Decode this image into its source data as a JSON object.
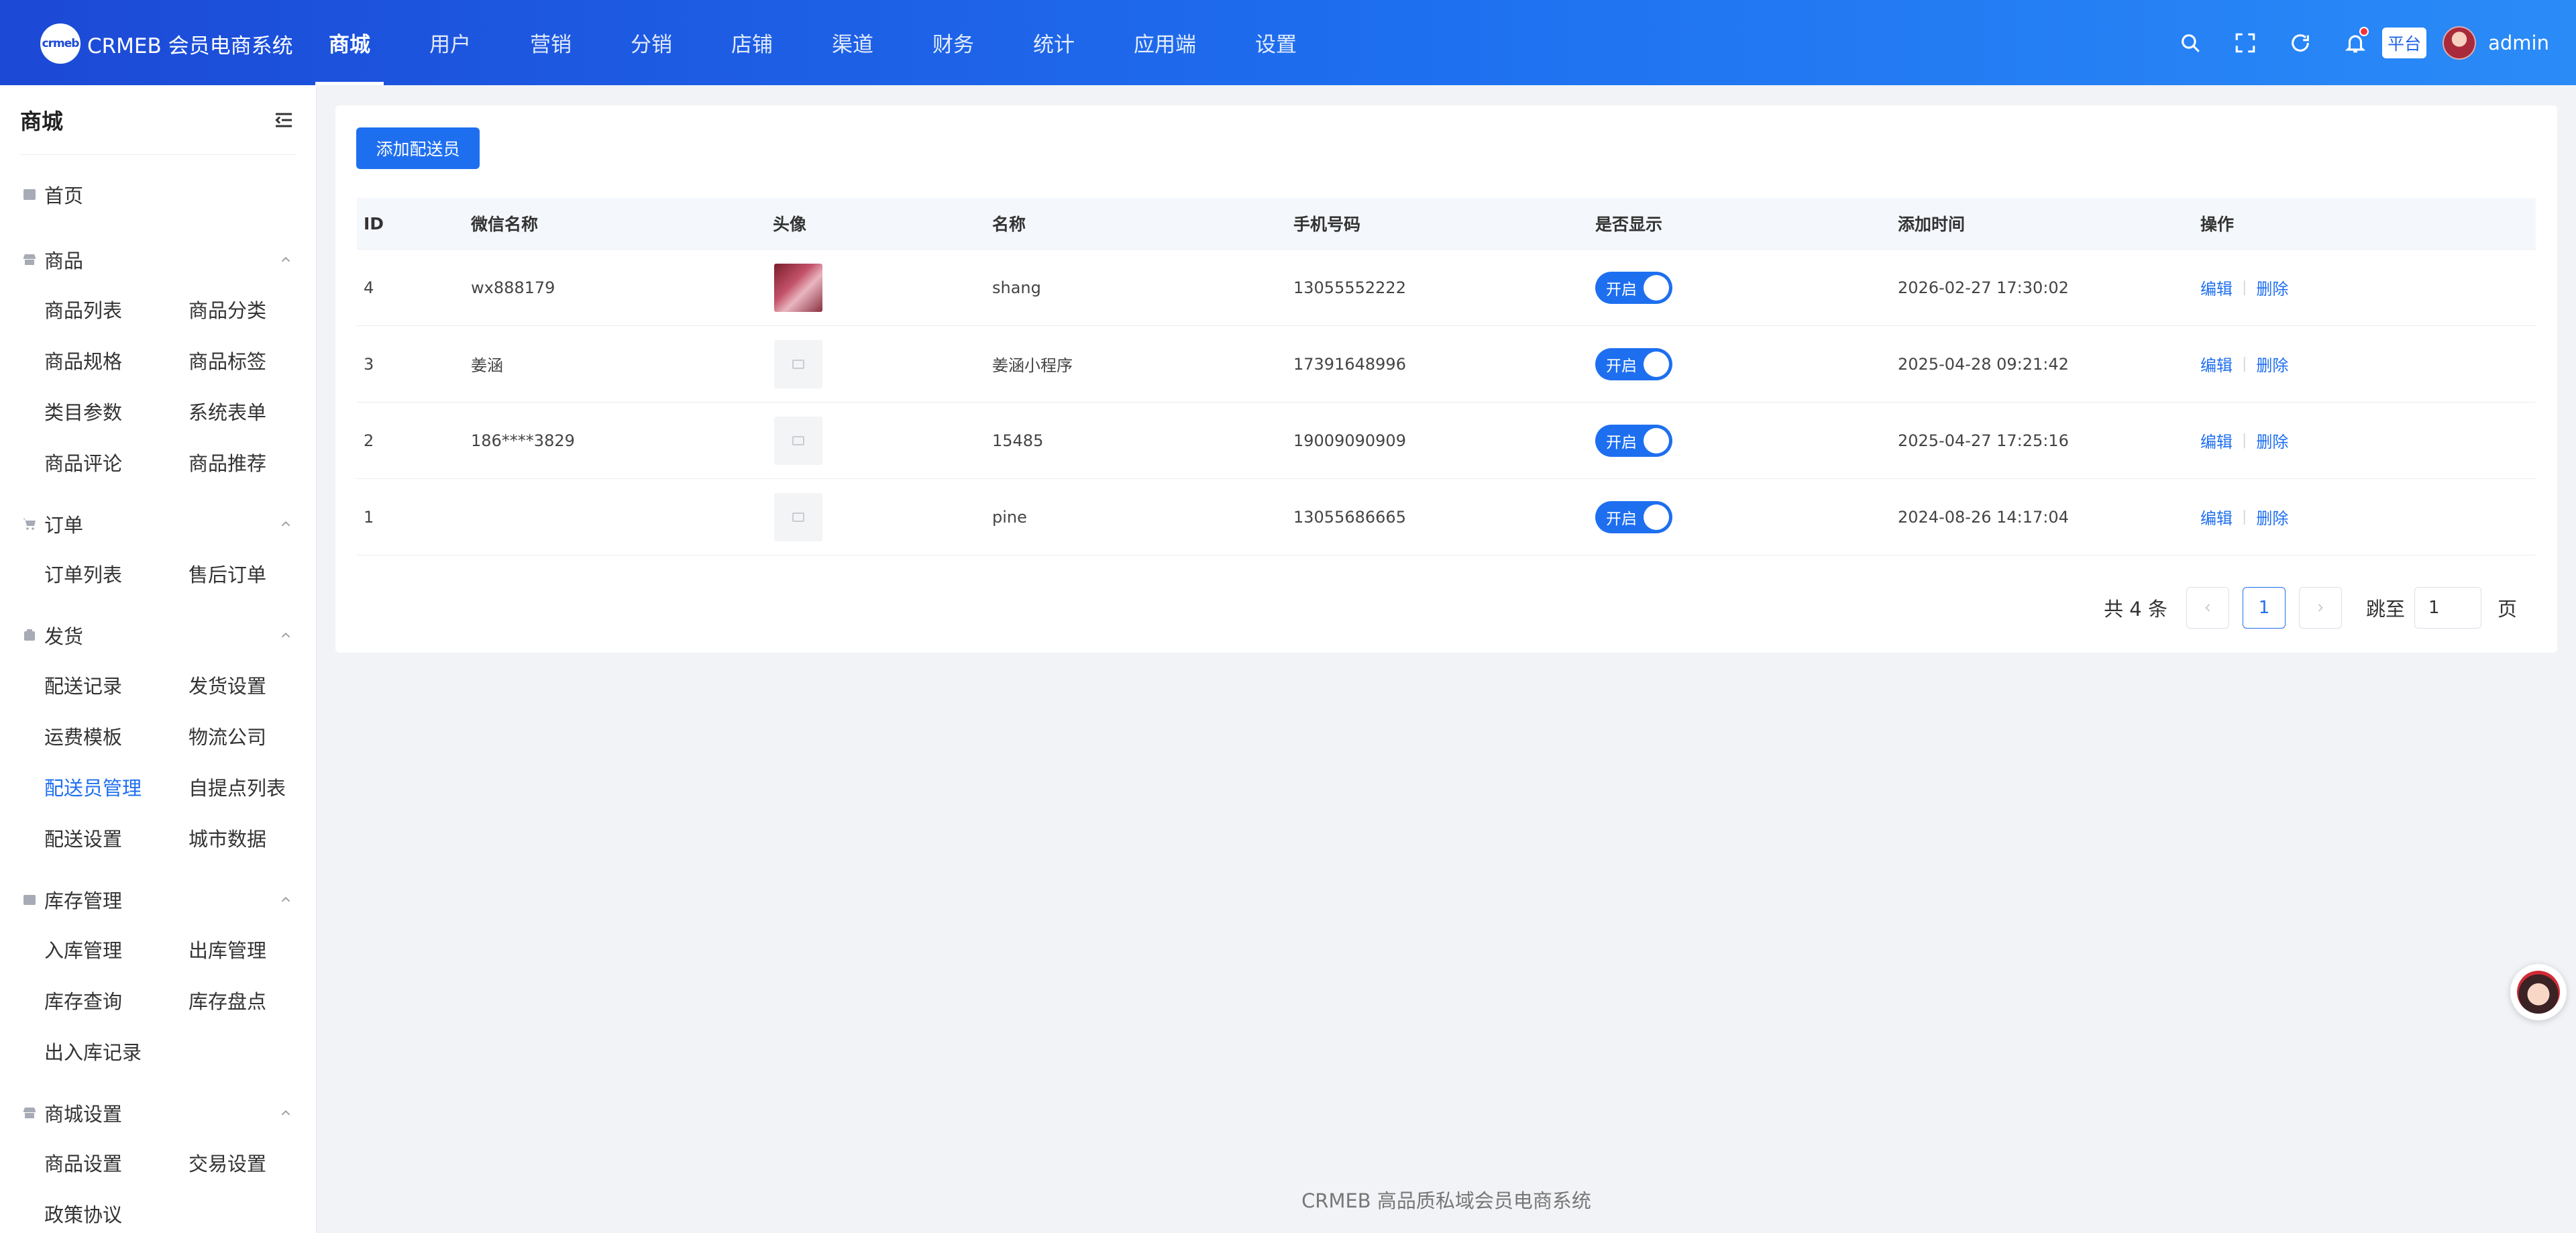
{
  "brand": {
    "logo_text": "crmeb",
    "title": "CRMEB 会员电商系统"
  },
  "topnav": [
    {
      "label": "商城",
      "active": true
    },
    {
      "label": "用户"
    },
    {
      "label": "营销"
    },
    {
      "label": "分销"
    },
    {
      "label": "店铺"
    },
    {
      "label": "渠道"
    },
    {
      "label": "财务"
    },
    {
      "label": "统计"
    },
    {
      "label": "应用端"
    },
    {
      "label": "设置"
    }
  ],
  "topbar_right": {
    "icons": [
      "search-icon",
      "fullscreen-icon",
      "refresh-icon",
      "bell-icon"
    ],
    "platform_badge": "平台",
    "user": "admin"
  },
  "sidebar": {
    "title": "商城",
    "home": "首页",
    "groups": [
      {
        "title": "商品",
        "items": [
          "商品列表",
          "商品分类",
          "商品规格",
          "商品标签",
          "类目参数",
          "系统表单",
          "商品评论",
          "商品推荐"
        ]
      },
      {
        "title": "订单",
        "items": [
          "订单列表",
          "售后订单"
        ]
      },
      {
        "title": "发货",
        "items": [
          "配送记录",
          "发货设置",
          "运费模板",
          "物流公司",
          "配送员管理",
          "自提点列表",
          "配送设置",
          "城市数据"
        ]
      },
      {
        "title": "库存管理",
        "items": [
          "入库管理",
          "出库管理",
          "库存查询",
          "库存盘点",
          "出入库记录"
        ]
      },
      {
        "title": "商城设置",
        "items": [
          "商品设置",
          "交易设置",
          "政策协议"
        ]
      }
    ],
    "active_item": "配送员管理"
  },
  "main": {
    "add_button": "添加配送员",
    "table": {
      "headers": [
        "ID",
        "微信名称",
        "头像",
        "名称",
        "手机号码",
        "是否显示",
        "添加时间",
        "操作"
      ],
      "rows": [
        {
          "id": "4",
          "wechat": "wx888179",
          "avatar": "photo",
          "name": "shang",
          "phone": "13055552222",
          "show": "开启",
          "time": "2026-02-27 17:30:02"
        },
        {
          "id": "3",
          "wechat": "姜涵",
          "avatar": "empty",
          "name": "姜涵小程序",
          "phone": "17391648996",
          "show": "开启",
          "time": "2025-04-28 09:21:42"
        },
        {
          "id": "2",
          "wechat": "186****3829",
          "avatar": "empty",
          "name": "15485",
          "phone": "19009090909",
          "show": "开启",
          "time": "2025-04-27 17:25:16"
        },
        {
          "id": "1",
          "wechat": "",
          "avatar": "empty",
          "name": "pine",
          "phone": "13055686665",
          "show": "开启",
          "time": "2024-08-26 14:17:04"
        }
      ],
      "actions": {
        "edit": "编辑",
        "delete": "删除"
      }
    },
    "pagination": {
      "total": "共 4 条",
      "current_page": "1",
      "jump_label": "跳至",
      "jump_value": "1",
      "unit": "页"
    }
  },
  "footer": "CRMEB 高品质私域会员电商系统",
  "colors": {
    "primary": "#1e6ff0",
    "topbar_start": "#1c49d6",
    "topbar_end": "#2a8bf7",
    "page_bg": "#f1f3f6"
  }
}
